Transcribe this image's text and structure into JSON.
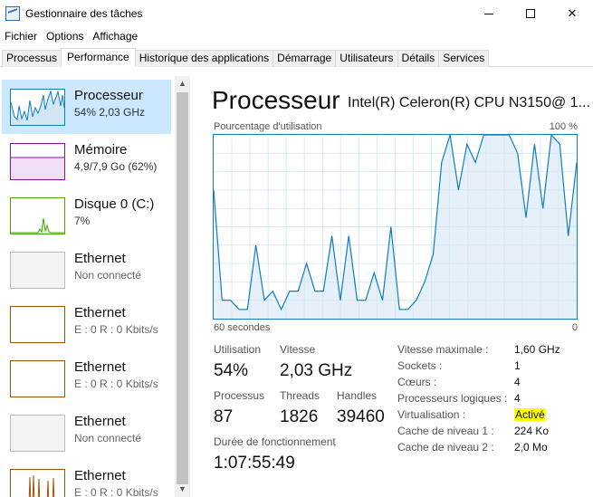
{
  "window": {
    "title": "Gestionnaire des tâches"
  },
  "menu": [
    "Fichier",
    "Options",
    "Affichage"
  ],
  "tabs": [
    {
      "label": "Processus"
    },
    {
      "label": "Performance"
    },
    {
      "label": "Historique des applications"
    },
    {
      "label": "Démarrage"
    },
    {
      "label": "Utilisateurs"
    },
    {
      "label": "Détails"
    },
    {
      "label": "Services"
    }
  ],
  "active_tab": "Performance",
  "sidebar": {
    "items": [
      {
        "title": "Processeur",
        "subtitle": "54% 2,03 GHz",
        "color": "#117dbb"
      },
      {
        "title": "Mémoire",
        "subtitle": "4,9/7,9 Go (62%)",
        "color": "#8b12ae"
      },
      {
        "title": "Disque 0 (C:)",
        "subtitle": "7%",
        "color": "#4da60c"
      },
      {
        "title": "Ethernet",
        "subtitle": "Non connecté",
        "color": "#aaaaaa"
      },
      {
        "title": "Ethernet",
        "subtitle": "E : 0 R : 0 Kbits/s",
        "color": "#a74f01"
      },
      {
        "title": "Ethernet",
        "subtitle": "E : 0 R : 0 Kbits/s",
        "color": "#a74f01"
      },
      {
        "title": "Ethernet",
        "subtitle": "Non connecté",
        "color": "#aaaaaa"
      },
      {
        "title": "Ethernet",
        "subtitle": "E : 0 R : 0 Kbits/s",
        "color": "#a74f01"
      }
    ]
  },
  "main": {
    "title": "Processeur",
    "cpu_name": "Intel(R) Celeron(R) CPU N3150@ 1...",
    "graph_label": "Pourcentage d'utilisation",
    "graph_max": "100 %",
    "axis_left": "60 secondes",
    "axis_right": "0",
    "stats": {
      "utilisation_label": "Utilisation",
      "utilisation_value": "54%",
      "vitesse_label": "Vitesse",
      "vitesse_value": "2,03 GHz",
      "processus_label": "Processus",
      "processus_value": "87",
      "threads_label": "Threads",
      "threads_value": "1826",
      "handles_label": "Handles",
      "handles_value": "39460",
      "duree_label": "Durée de fonctionnement",
      "duree_value": "1:07:55:49"
    },
    "info": [
      {
        "label": "Vitesse maximale :",
        "value": "1,60 GHz"
      },
      {
        "label": "Sockets :",
        "value": "1"
      },
      {
        "label": "Cœurs :",
        "value": "4"
      },
      {
        "label": "Processeurs logiques :",
        "value": "4"
      },
      {
        "label": "Virtualisation :",
        "value": "Activé"
      },
      {
        "label": "Cache de niveau 1 :",
        "value": "224 Ko"
      },
      {
        "label": "Cache de niveau 2 :",
        "value": "2,0 Mo"
      }
    ]
  },
  "cpu_history": [
    70,
    10,
    10,
    5,
    5,
    40,
    10,
    15,
    5,
    15,
    15,
    30,
    15,
    15,
    45,
    10,
    45,
    10,
    10,
    25,
    10,
    50,
    5,
    5,
    10,
    20,
    35,
    85,
    100,
    70,
    95,
    85,
    100,
    100,
    100,
    100,
    90,
    55,
    95,
    60,
    100,
    95,
    45,
    85
  ],
  "colors": {
    "accent": "#117dbb",
    "selected": "#cce8ff",
    "highlight": "#ffff00"
  }
}
